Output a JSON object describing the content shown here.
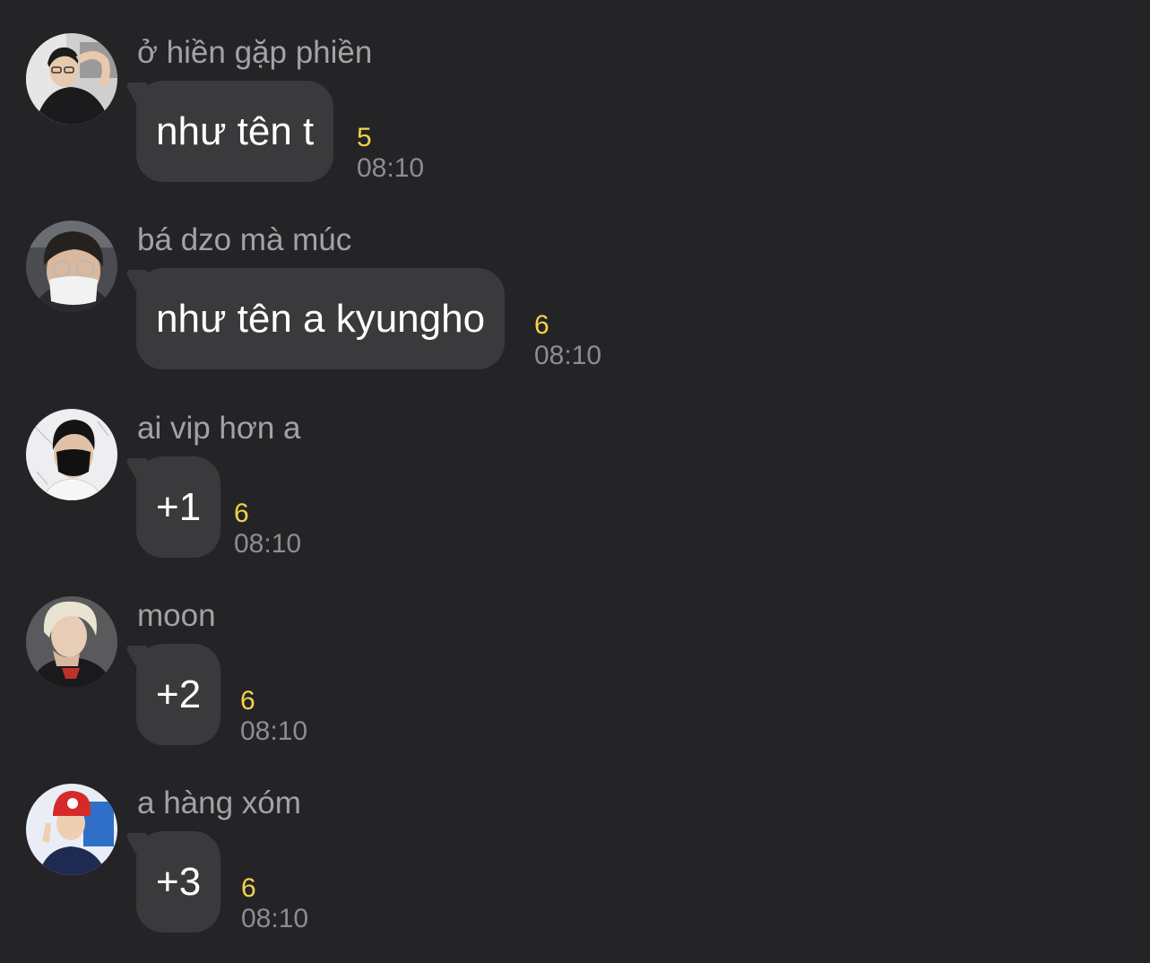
{
  "messages": [
    {
      "sender": "ở hiền gặp phiền",
      "text": "như tên t",
      "unread": "5",
      "time": "08:10",
      "avatar": "avatar-photo"
    },
    {
      "sender": "bá dzo mà múc",
      "text": "như tên a kyungho",
      "unread": "6",
      "time": "08:10",
      "avatar": "avatar-photo"
    },
    {
      "sender": "ai vip hơn a",
      "text": "+1",
      "unread": "6",
      "time": "08:10",
      "avatar": "avatar-photo"
    },
    {
      "sender": "moon",
      "text": "+2",
      "unread": "6",
      "time": "08:10",
      "avatar": "avatar-photo"
    },
    {
      "sender": "a hàng xóm",
      "text": "+3",
      "unread": "6",
      "time": "08:10",
      "avatar": "avatar-photo"
    }
  ],
  "colors": {
    "background": "#242426",
    "bubble": "#3a3a3c",
    "message_text": "#ffffff",
    "sender_name": "#a3a3a6",
    "unread_count": "#f2d34a",
    "timestamp": "#8d8d91"
  }
}
